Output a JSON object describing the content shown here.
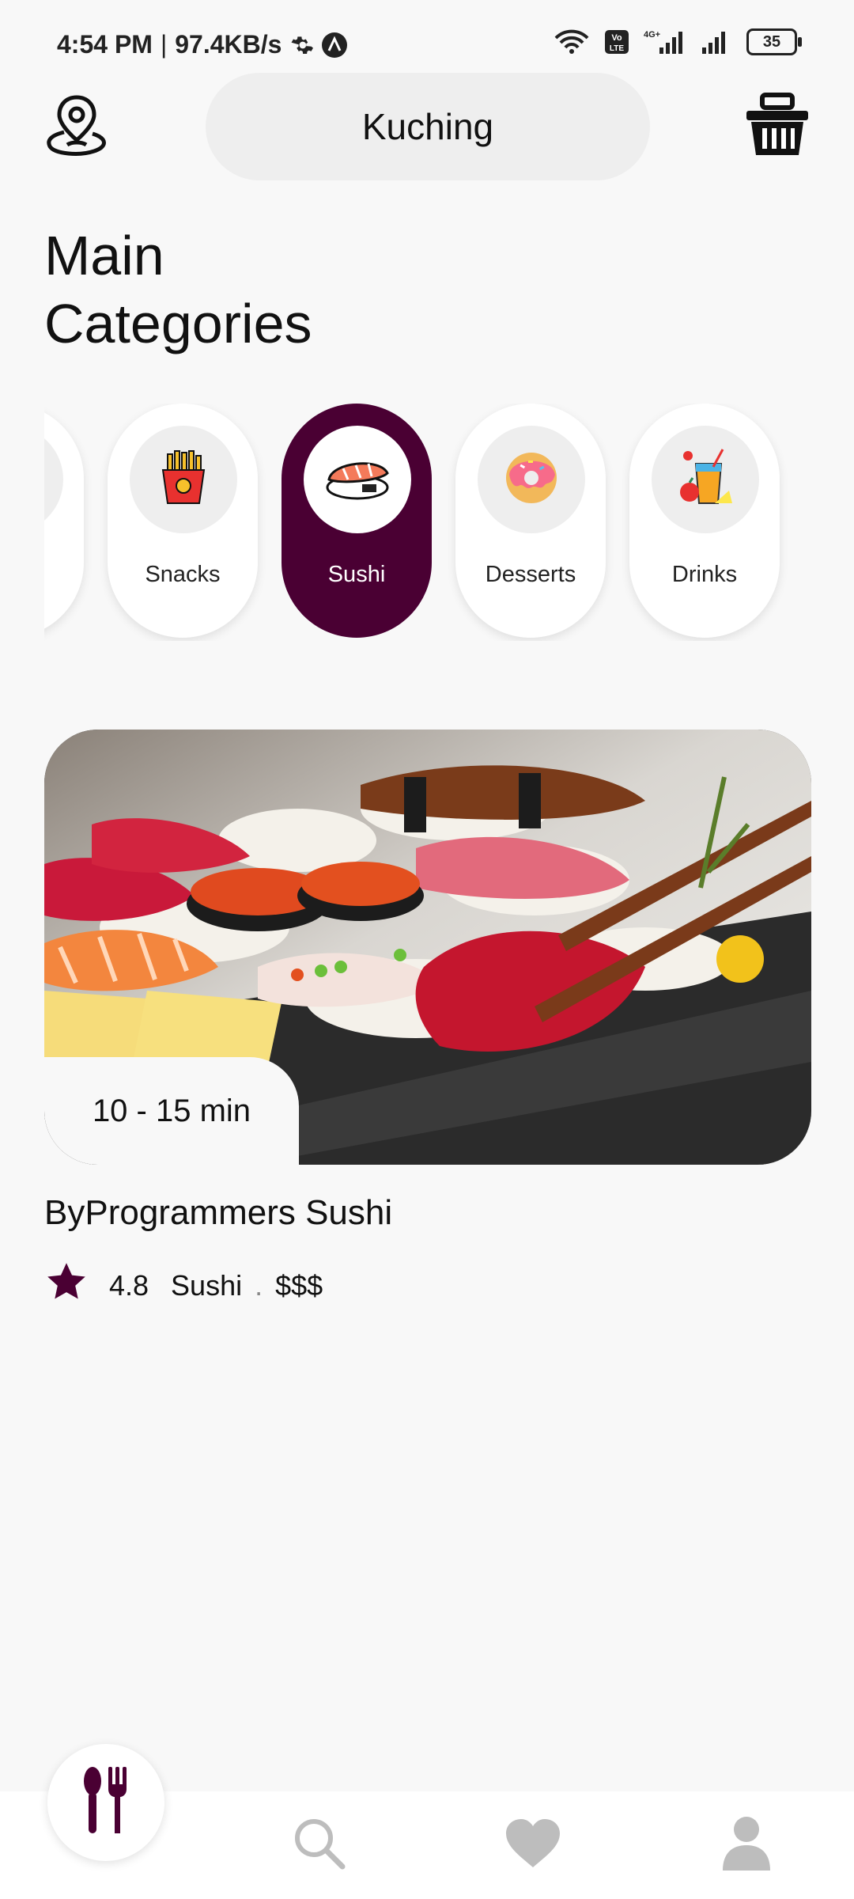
{
  "status_bar": {
    "time": "4:54 PM",
    "separator": "|",
    "speed": "97.4KB/s",
    "network_label": "4G+",
    "volte_label": "Vo LTE",
    "battery": "35"
  },
  "header": {
    "city": "Kuching",
    "location_icon": "map-pin-icon",
    "cart_icon": "basket-icon"
  },
  "page_title": "Main\nCategories",
  "categories": [
    {
      "label": "",
      "icon": "burger-icon",
      "active": false
    },
    {
      "label": "Snacks",
      "icon": "fries-icon",
      "active": false
    },
    {
      "label": "Sushi",
      "icon": "sushi-icon",
      "active": true
    },
    {
      "label": "Desserts",
      "icon": "donut-icon",
      "active": false
    },
    {
      "label": "Drinks",
      "icon": "drink-icon",
      "active": false
    }
  ],
  "restaurant": {
    "delivery_time": "10 - 15 min",
    "name": "ByProgrammers Sushi",
    "rating": "4.8",
    "category": "Sushi",
    "dot": ".",
    "price": "$$$"
  },
  "bottom_nav": [
    {
      "name": "home",
      "icon": "cutlery-icon",
      "active": true
    },
    {
      "name": "search",
      "icon": "search-icon",
      "active": false
    },
    {
      "name": "favourites",
      "icon": "heart-icon",
      "active": false
    },
    {
      "name": "profile",
      "icon": "user-icon",
      "active": false
    }
  ],
  "colors": {
    "accent": "#4a0033",
    "background": "#f8f8f8",
    "pill": "#eeeeee",
    "inactive_icon": "#bdbdbd"
  }
}
